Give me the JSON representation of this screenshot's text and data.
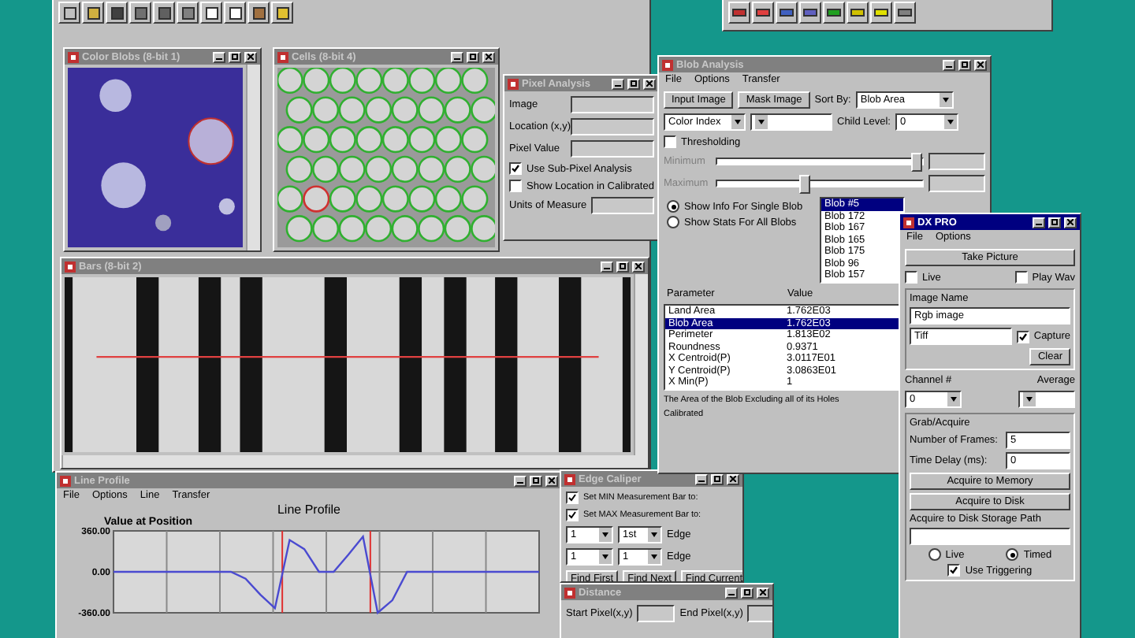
{
  "color_blobs": {
    "title": "Color Blobs (8-bit 1)",
    "active": false
  },
  "cells": {
    "title": "Cells (8-bit 4)",
    "active": false
  },
  "pixel_analysis": {
    "title": "Pixel Analysis",
    "active": false,
    "fields": [
      "Image",
      "Location (x,y)",
      "Pixel Value"
    ],
    "checks": [
      {
        "label": "Use Sub-Pixel Analysis",
        "checked": true
      },
      {
        "label": "Show Location in Calibrated",
        "checked": false
      }
    ],
    "units_label": "Units of Measure"
  },
  "bars": {
    "title": "Bars (8-bit 2)",
    "active": false
  },
  "line_profile": {
    "title": "Line Profile",
    "active": false,
    "menu": [
      "File",
      "Options",
      "Line",
      "Transfer"
    ],
    "chart_data": {
      "type": "line",
      "title": "Line Profile",
      "ylabel": "Value at Position",
      "grid": true,
      "ylim": [
        -360,
        360
      ],
      "yticks": [
        {
          "value": 360,
          "label": "360.00"
        },
        {
          "value": 0,
          "label": "0.00"
        },
        {
          "value": -360,
          "label": "-360.00"
        }
      ],
      "series": [
        {
          "color": "#4a4ad0",
          "values": [
            0,
            0,
            0,
            0,
            0,
            0,
            0,
            0,
            0,
            -60,
            -200,
            -320,
            280,
            200,
            0,
            0,
            150,
            310,
            -360,
            -250,
            0,
            0,
            0,
            0,
            0,
            0,
            0,
            0,
            0,
            0
          ]
        }
      ]
    }
  },
  "blob_analysis": {
    "title": "Blob Analysis",
    "active": false,
    "menu": [
      "File",
      "Options",
      "Transfer"
    ],
    "buttons": [
      "Input Image",
      "Mask Image"
    ],
    "sort_label": "Sort By:",
    "sort_value": "Blob Area",
    "index_value": "Color Index",
    "child_label": "Child Level:",
    "child_value": "0",
    "thresholding": {
      "label": "Thresholding",
      "checked": false
    },
    "sliders": [
      {
        "label": "Minimum",
        "level": 0.97
      },
      {
        "label": "Maximum",
        "level": 0.42
      }
    ],
    "modes": [
      {
        "label": "Show Info For Single Blob",
        "selected": true
      },
      {
        "label": "Show Stats For All Blobs",
        "selected": false
      }
    ],
    "blobs": [
      {
        "label": "Blob #5",
        "selected": true
      },
      {
        "label": "Blob 172",
        "selected": false
      },
      {
        "label": "Blob 167",
        "selected": false
      },
      {
        "label": "Blob 165",
        "selected": false
      },
      {
        "label": "Blob 175",
        "selected": false
      },
      {
        "label": "Blob 96",
        "selected": false
      },
      {
        "label": "Blob 157",
        "selected": false
      }
    ],
    "columns": [
      "Parameter",
      "Value"
    ],
    "rows": [
      {
        "cells": [
          "Land Area",
          "1.762E03"
        ],
        "selected": false
      },
      {
        "cells": [
          "Blob Area",
          "1.762E03"
        ],
        "selected": true
      },
      {
        "cells": [
          "Perimeter",
          "1.813E02"
        ],
        "selected": false
      },
      {
        "cells": [
          "Roundness",
          "0.9371"
        ],
        "selected": false
      },
      {
        "cells": [
          "X Centroid(P)",
          "3.0117E01"
        ],
        "selected": false
      },
      {
        "cells": [
          "Y Centroid(P)",
          "3.0863E01"
        ],
        "selected": false
      },
      {
        "cells": [
          "X Min(P)",
          "1"
        ],
        "selected": false
      }
    ],
    "description": "The Area of the Blob Excluding all of its Holes",
    "units": "Calibrated"
  },
  "edge_caliper": {
    "title": "Edge Caliper",
    "active": false,
    "rows": [
      {
        "label": "Set MIN Measurement Bar to:",
        "checked": true,
        "value_1": "1",
        "value_2": "1st",
        "suffix": "Edge"
      },
      {
        "label": "Set MAX Measurement Bar to:",
        "checked": true,
        "value_1": "1",
        "value_2": "1",
        "suffix": "Edge"
      }
    ],
    "buttons": [
      "Find First",
      "Find Next",
      "Find Current"
    ]
  },
  "distance": {
    "title": "Distance",
    "active": false,
    "fields": [
      "Start Pixel(x,y)",
      "End Pixel(x,y)"
    ]
  },
  "grab": {
    "title": "DX PRO",
    "active": true,
    "menu": [
      "File",
      "Options"
    ],
    "take": "Take Picture",
    "checks": [
      {
        "label": "Live",
        "checked": false
      },
      {
        "label": "Play Wav",
        "checked": false
      }
    ],
    "image_label": "Image Name",
    "image_value": "Rgb image",
    "type_value": "Tiff",
    "capture": {
      "label": "Capture",
      "checked": true
    },
    "clear": "Clear",
    "channel_label": "Channel #",
    "channel_value": "0",
    "average_label": "Average",
    "group_label": "Grab/Acquire",
    "frames_label": "Number of Frames:",
    "frames_value": "5",
    "delay_label": "Time Delay (ms):",
    "delay_value": "0",
    "acquire": [
      "Acquire to Memory",
      "Acquire to Disk"
    ],
    "path_label": "Acquire to Disk Storage Path",
    "modes": [
      {
        "label": "Live",
        "selected": false
      },
      {
        "label": "Timed",
        "selected": true
      }
    ],
    "trigger": {
      "label": "Use Triggering",
      "checked": true
    }
  }
}
